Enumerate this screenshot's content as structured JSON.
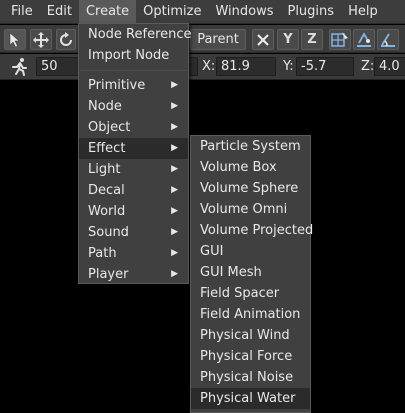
{
  "menubar": {
    "items": [
      "File",
      "Edit",
      "Create",
      "Optimize",
      "Windows",
      "Plugins",
      "Help"
    ]
  },
  "toolbar": {
    "parent_label": "Parent",
    "axis_x": "X",
    "axis_y": "Y",
    "axis_z": "Z"
  },
  "toolbar2": {
    "step_value": "50",
    "x_label": "X:",
    "x_value": "81.9",
    "y_label": "Y:",
    "y_value": "-5.7",
    "z_label": "Z:",
    "z_value": "4.0"
  },
  "create_menu": {
    "top_items": [
      "Node Reference",
      "Import Node"
    ],
    "sub_items": [
      "Primitive",
      "Node",
      "Object",
      "Effect",
      "Light",
      "Decal",
      "World",
      "Sound",
      "Path",
      "Player"
    ],
    "highlighted": "Effect"
  },
  "effect_menu": {
    "items": [
      "Particle System",
      "Volume Box",
      "Volume Sphere",
      "Volume Omni",
      "Volume Projected",
      "GUI",
      "GUI Mesh",
      "Field Spacer",
      "Field Animation",
      "Physical Wind",
      "Physical Force",
      "Physical Noise",
      "Physical Water"
    ],
    "highlighted": "Physical Water"
  },
  "colors": {
    "menubar_bg": "#3d3d3d",
    "menu_bg": "#404040",
    "highlight_bg": "#2b2b2b",
    "accent_icon": "#7fb7e6"
  }
}
